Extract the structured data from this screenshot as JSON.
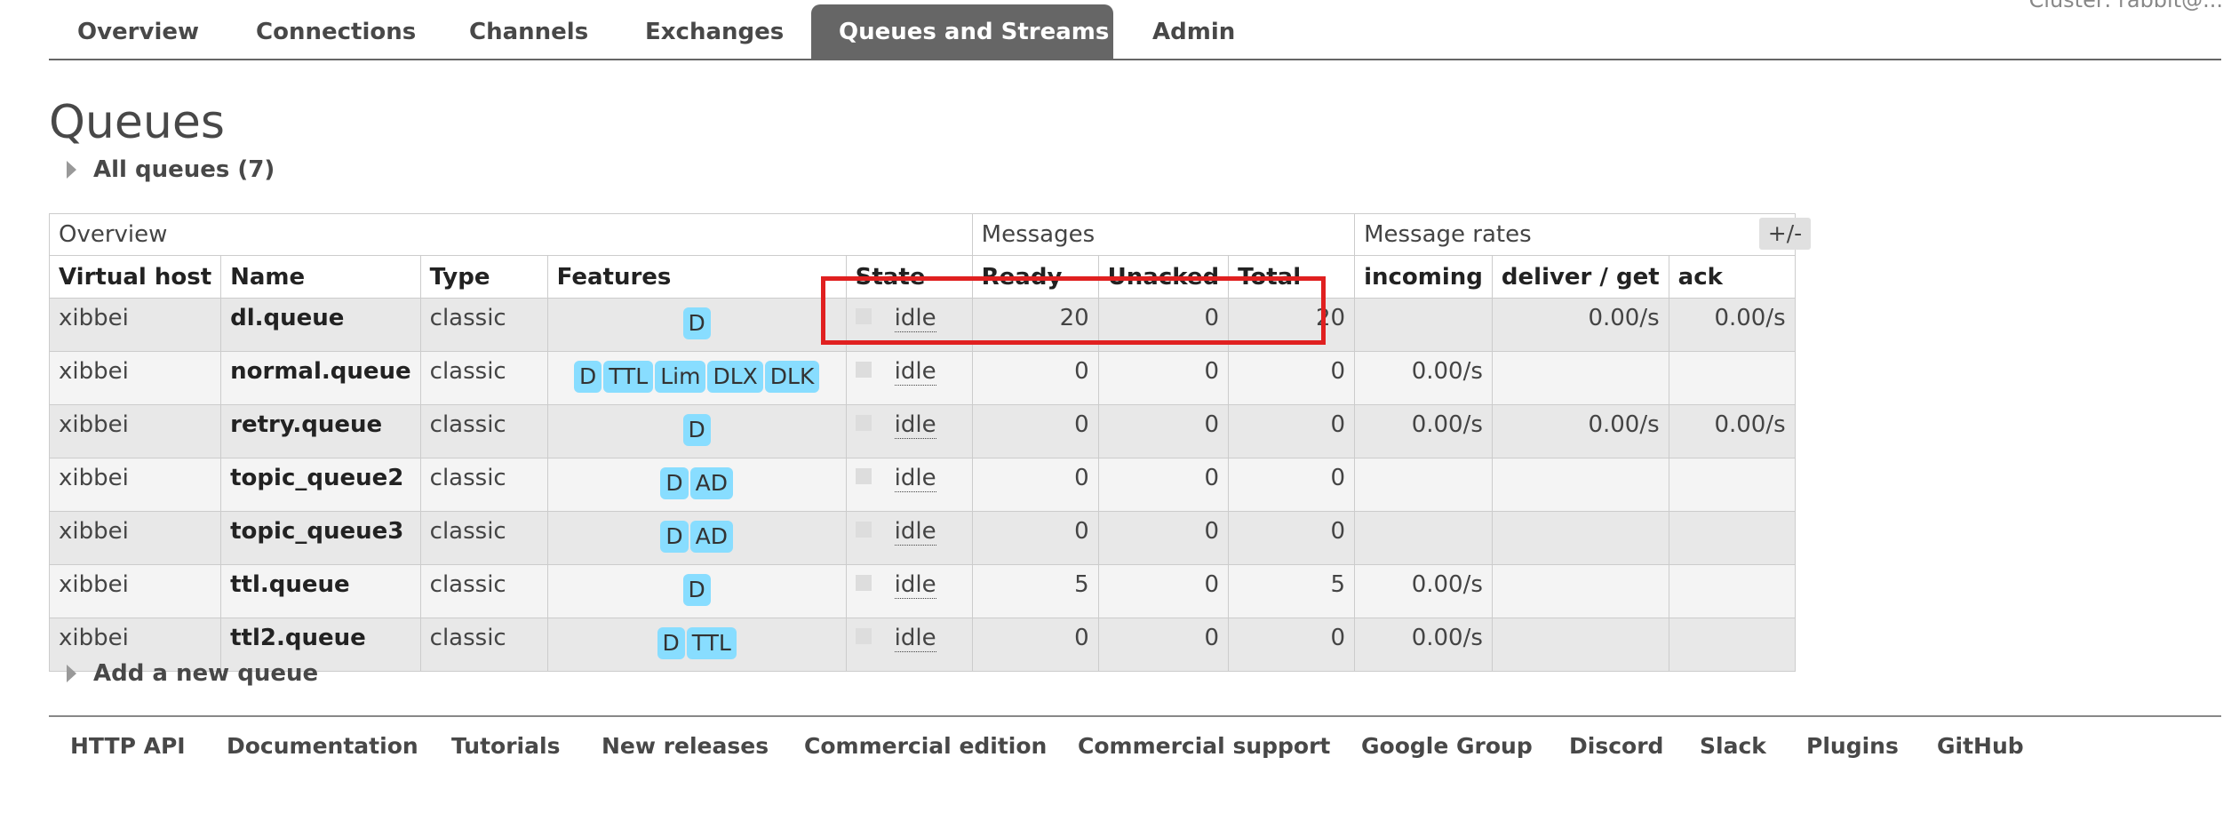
{
  "header": {
    "cluster_label": "Cluster: rabbit@..."
  },
  "tabs": [
    {
      "label": "Overview",
      "active": false
    },
    {
      "label": "Connections",
      "active": false
    },
    {
      "label": "Channels",
      "active": false
    },
    {
      "label": "Exchanges",
      "active": false
    },
    {
      "label": "Queues and Streams",
      "active": true
    },
    {
      "label": "Admin",
      "active": false
    }
  ],
  "page": {
    "title": "Queues",
    "all_queues_label": "All queues (7)",
    "add_queue_label": "Add a new queue",
    "toggle_icon": "triangle-right-icon"
  },
  "table": {
    "groups": {
      "overview": "Overview",
      "messages": "Messages",
      "rates": "Message rates"
    },
    "columns": [
      "Virtual host",
      "Name",
      "Type",
      "Features",
      "State",
      "Ready",
      "Unacked",
      "Total",
      "incoming",
      "deliver / get",
      "ack"
    ],
    "columns_toggle": "+/-",
    "rows": [
      {
        "vhost": "xibbei",
        "name": "dl.queue",
        "type": "classic",
        "features": [
          "D"
        ],
        "state": "idle",
        "ready": "20",
        "unacked": "0",
        "total": "20",
        "incoming": "",
        "deliver_get": "0.00/s",
        "ack": "0.00/s"
      },
      {
        "vhost": "xibbei",
        "name": "normal.queue",
        "type": "classic",
        "features": [
          "D",
          "TTL",
          "Lim",
          "DLX",
          "DLK"
        ],
        "state": "idle",
        "ready": "0",
        "unacked": "0",
        "total": "0",
        "incoming": "0.00/s",
        "deliver_get": "",
        "ack": ""
      },
      {
        "vhost": "xibbei",
        "name": "retry.queue",
        "type": "classic",
        "features": [
          "D"
        ],
        "state": "idle",
        "ready": "0",
        "unacked": "0",
        "total": "0",
        "incoming": "0.00/s",
        "deliver_get": "0.00/s",
        "ack": "0.00/s"
      },
      {
        "vhost": "xibbei",
        "name": "topic_queue2",
        "type": "classic",
        "features": [
          "D",
          "AD"
        ],
        "state": "idle",
        "ready": "0",
        "unacked": "0",
        "total": "0",
        "incoming": "",
        "deliver_get": "",
        "ack": ""
      },
      {
        "vhost": "xibbei",
        "name": "topic_queue3",
        "type": "classic",
        "features": [
          "D",
          "AD"
        ],
        "state": "idle",
        "ready": "0",
        "unacked": "0",
        "total": "0",
        "incoming": "",
        "deliver_get": "",
        "ack": ""
      },
      {
        "vhost": "xibbei",
        "name": "ttl.queue",
        "type": "classic",
        "features": [
          "D"
        ],
        "state": "idle",
        "ready": "5",
        "unacked": "0",
        "total": "5",
        "incoming": "0.00/s",
        "deliver_get": "",
        "ack": ""
      },
      {
        "vhost": "xibbei",
        "name": "ttl2.queue",
        "type": "classic",
        "features": [
          "D",
          "TTL"
        ],
        "state": "idle",
        "ready": "0",
        "unacked": "0",
        "total": "0",
        "incoming": "0.00/s",
        "deliver_get": "",
        "ack": ""
      }
    ]
  },
  "colors": {
    "highlight": "#e02020",
    "badge": "#88ddff",
    "active_tab": "#666666"
  },
  "footer": {
    "links": [
      "HTTP API",
      "Documentation",
      "Tutorials",
      "New releases",
      "Commercial edition",
      "Commercial support",
      "Google Group",
      "Discord",
      "Slack",
      "Plugins",
      "GitHub"
    ]
  }
}
